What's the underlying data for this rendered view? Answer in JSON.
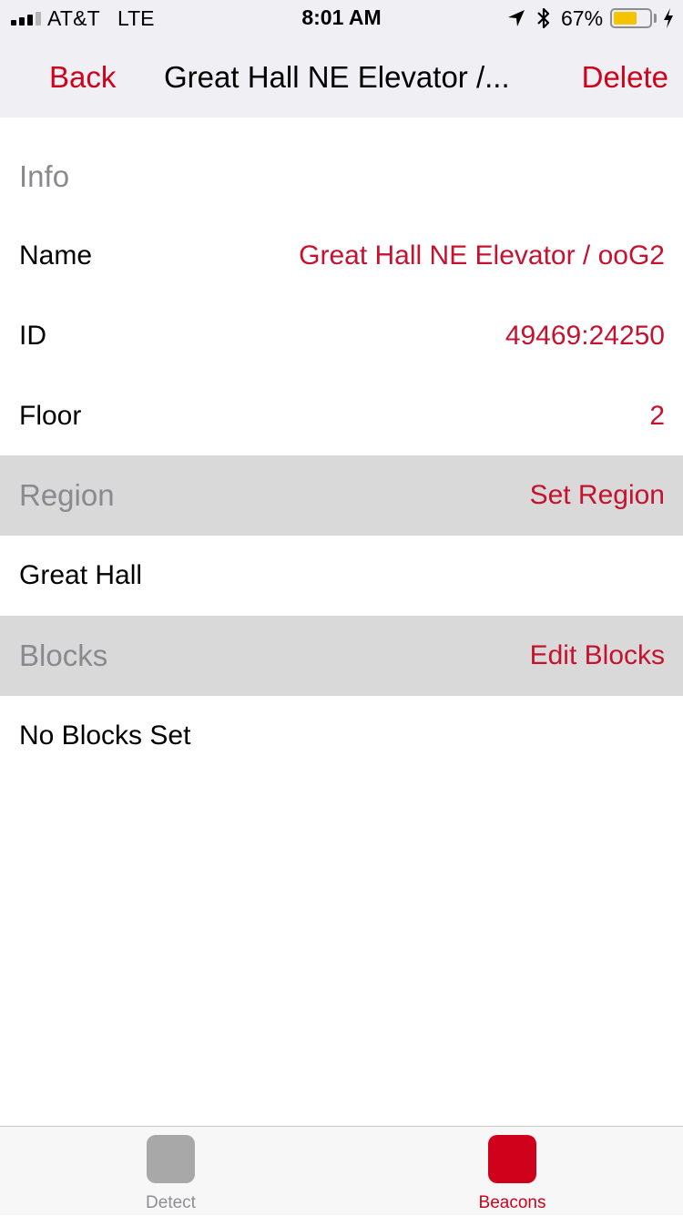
{
  "status_bar": {
    "carrier": "AT&T",
    "network": "LTE",
    "time": "8:01 AM",
    "battery_percent": "67%",
    "battery_level": 0.67,
    "icons": [
      "signal-icon",
      "location-arrow-icon",
      "bluetooth-icon",
      "battery-icon",
      "charging-bolt-icon"
    ]
  },
  "nav": {
    "back_label": "Back",
    "title": "Great Hall NE Elevator /...",
    "delete_label": "Delete"
  },
  "info_section": {
    "header": "Info",
    "rows": [
      {
        "label": "Name",
        "value": "Great Hall NE Elevator / ooG2"
      },
      {
        "label": "ID",
        "value": "49469:24250"
      },
      {
        "label": "Floor",
        "value": "2"
      }
    ]
  },
  "region_section": {
    "header": "Region",
    "action_label": "Set Region",
    "value": "Great Hall"
  },
  "blocks_section": {
    "header": "Blocks",
    "action_label": "Edit Blocks",
    "value": "No Blocks Set"
  },
  "tab_bar": {
    "tabs": [
      {
        "label": "Detect",
        "active": false,
        "color": "#a8a8a8"
      },
      {
        "label": "Beacons",
        "active": true,
        "color": "#d0021b"
      }
    ]
  },
  "colors": {
    "accent": "#d0021b",
    "value_text": "#c4122f",
    "section_background": "#d9d9d9",
    "bar_background": "#efeff4"
  }
}
